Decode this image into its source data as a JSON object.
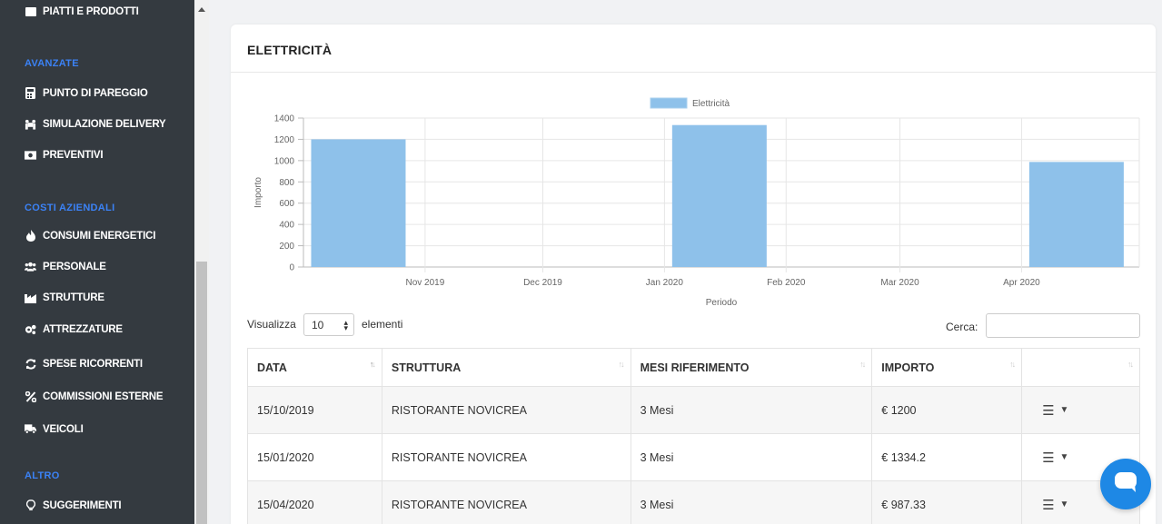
{
  "sidebar": {
    "top_item": "PIATTI E PRODOTTI",
    "sections": [
      {
        "heading": "AVANZATE",
        "items": [
          {
            "label": "PUNTO DI PAREGGIO",
            "icon": "calculator-icon"
          },
          {
            "label": "SIMULAZIONE DELIVERY",
            "icon": "people-carry-icon"
          },
          {
            "label": "PREVENTIVI",
            "icon": "money-bill-icon"
          }
        ]
      },
      {
        "heading": "COSTI AZIENDALI",
        "items": [
          {
            "label": "CONSUMI ENERGETICI",
            "icon": "fire-icon"
          },
          {
            "label": "PERSONALE",
            "icon": "users-icon"
          },
          {
            "label": "STRUTTURE",
            "icon": "industry-icon"
          },
          {
            "label": "ATTREZZATURE",
            "icon": "cogs-icon"
          },
          {
            "label": "SPESE RICORRENTI",
            "icon": "sync-icon"
          },
          {
            "label": "COMMISSIONI ESTERNE",
            "icon": "percent-icon"
          },
          {
            "label": "VEICOLI",
            "icon": "truck-icon"
          }
        ]
      },
      {
        "heading": "ALTRO",
        "items": [
          {
            "label": "SUGGERIMENTI",
            "icon": "lightbulb-icon"
          }
        ]
      }
    ]
  },
  "card": {
    "title": "ELETTRICITÀ"
  },
  "chart_data": {
    "type": "bar",
    "legend": [
      "Elettricità"
    ],
    "legend_position": "top",
    "xlabel": "Periodo",
    "ylabel": "Importo",
    "ylim": [
      0,
      1400
    ],
    "yticks": [
      0,
      200,
      400,
      600,
      800,
      1000,
      1200,
      1400
    ],
    "xticks": [
      "Nov 2019",
      "Dec 2019",
      "Jan 2020",
      "Feb 2020",
      "Mar 2020",
      "Apr 2020"
    ],
    "grid": true,
    "color": "#8ec1ea",
    "series": [
      {
        "name": "Elettricità",
        "points": [
          {
            "x": "2019-10-15",
            "y": 1200
          },
          {
            "x": "2020-01-15",
            "y": 1334.2
          },
          {
            "x": "2020-04-15",
            "y": 987.33
          }
        ]
      }
    ]
  },
  "controls": {
    "show_prefix": "Visualizza",
    "show_value": "10",
    "show_suffix": "elementi",
    "search_label": "Cerca:",
    "search_value": ""
  },
  "table": {
    "headers": [
      "DATA",
      "STRUTTURA",
      "MESI RIFERIMENTO",
      "IMPORTO",
      ""
    ],
    "rows": [
      {
        "data": "15/10/2019",
        "struttura": "RISTORANTE NOVICREA",
        "mesi": "3 Mesi",
        "importo": "€ 1200"
      },
      {
        "data": "15/01/2020",
        "struttura": "RISTORANTE NOVICREA",
        "mesi": "3 Mesi",
        "importo": "€ 1334.2"
      },
      {
        "data": "15/04/2020",
        "struttura": "RISTORANTE NOVICREA",
        "mesi": "3 Mesi",
        "importo": "€ 987.33"
      }
    ]
  },
  "chat": {
    "icon": "chat-bubble-icon",
    "color": "#1e88e5"
  }
}
